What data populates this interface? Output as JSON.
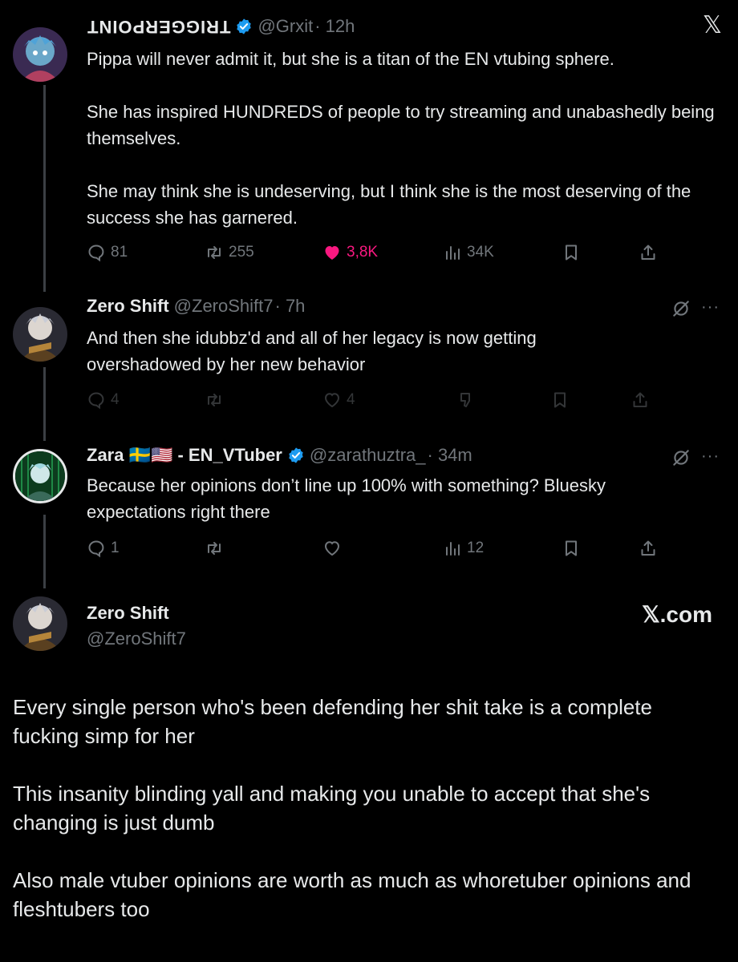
{
  "tweets": [
    {
      "name": "TRIGGERPOINT",
      "handle": "@Grxit",
      "time": "· 12h",
      "text": "Pippa will never admit it, but she is a titan of the EN vtubing sphere.\n\nShe has inspired HUNDREDS of people to try streaming and unabashedly being themselves.\n\nShe may think she is undeserving, but I think she is the most deserving of the success she has garnered.",
      "replies": "81",
      "reposts": "255",
      "likes": "3,8K",
      "views": "34K"
    },
    {
      "name": "Zero Shift",
      "handle": "@ZeroShift7",
      "time": "· 7h",
      "text": "And then she idubbz'd and all of her legacy is now getting overshadowed by her new behavior",
      "replies": "4",
      "likes": "4"
    },
    {
      "name": "Zara 🇸🇪🇺🇸 - EN_VTuber",
      "handle": "@zarathuztra_",
      "time": "· 34m",
      "text": "Because her opinions don’t line up 100% with something? Bluesky expectations right there",
      "replies": "1",
      "views": "12"
    }
  ],
  "embedded": {
    "name": "Zero Shift",
    "handle": "@ZeroShift7",
    "brand": "𝕏.com",
    "text": "Every single person who's been defending her shit take is a complete fucking simp for her\n\nThis insanity blinding yall and making you unable to accept that she's changing is just dumb\n\nAlso male vtuber opinions are worth as much as whoretuber opinions and fleshtubers too"
  },
  "close_glyph": "𝕏",
  "more_glyph": "···",
  "colors": {
    "background": "#000000",
    "text": "#e7e9ea",
    "muted": "#71767b",
    "like": "#f91880",
    "verified": "#1d9bf0"
  }
}
